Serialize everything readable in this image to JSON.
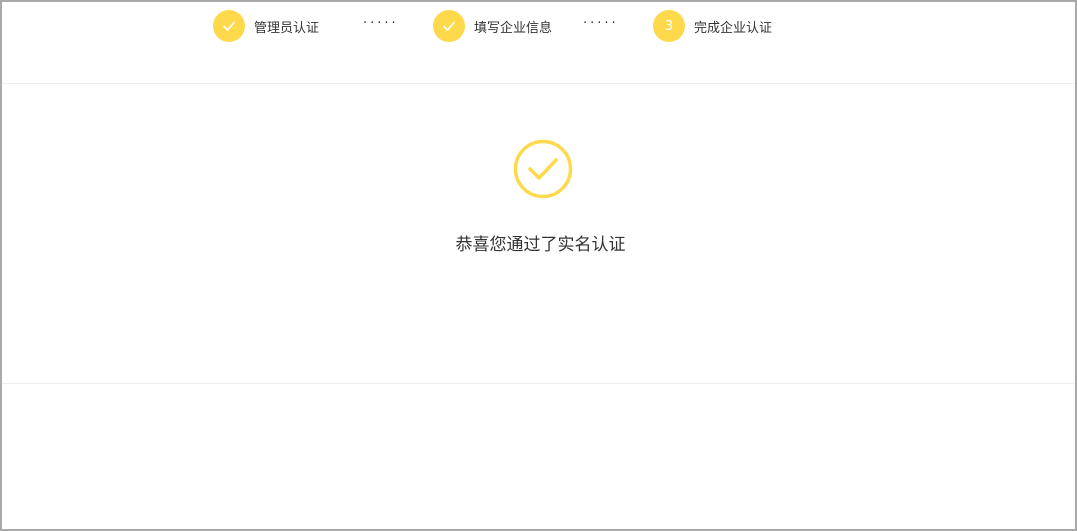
{
  "stepper": {
    "steps": [
      {
        "label": "管理员认证",
        "state": "done"
      },
      {
        "label": "填写企业信息",
        "state": "done"
      },
      {
        "label": "完成企业认证",
        "state": "current",
        "number": "3"
      }
    ],
    "separator": "·····"
  },
  "result": {
    "icon": "check-circle-icon",
    "message": "恭喜您通过了实名认证"
  },
  "colors": {
    "accent": "#fdd94b",
    "text": "#333333",
    "divider": "#eeeeee",
    "frame_border": "#a9a9a9"
  }
}
